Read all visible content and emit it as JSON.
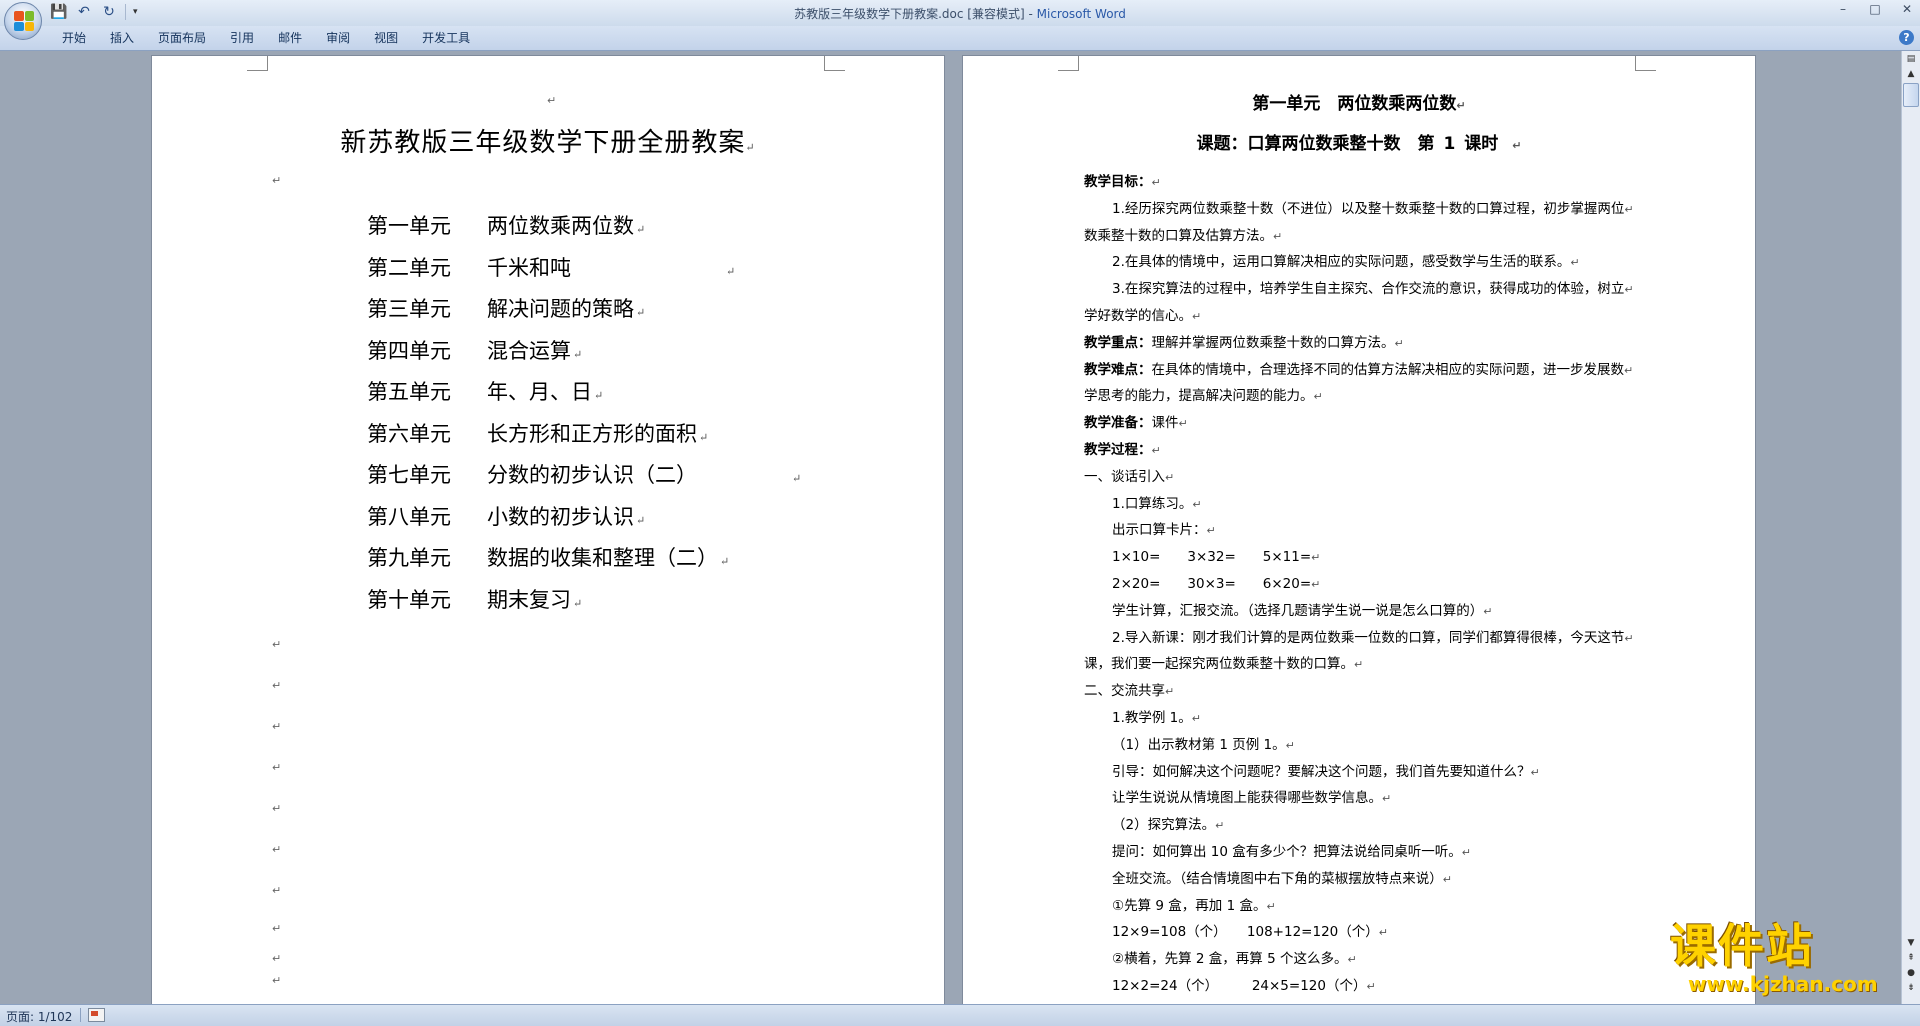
{
  "window": {
    "title_doc": "苏教版三年级数学下册教案.doc [兼容模式]",
    "title_app": "Microsoft Word",
    "controls": [
      "–",
      "□",
      "✕"
    ]
  },
  "qat": {
    "save_icon": "💾",
    "undo_icon": "↶",
    "redo_icon": "↻",
    "customize_icon": "▾"
  },
  "ribbon": {
    "tabs": [
      "开始",
      "插入",
      "页面布局",
      "引用",
      "邮件",
      "审阅",
      "视图",
      "开发工具"
    ],
    "help_icon": "?"
  },
  "left_page": {
    "title": "新苏教版三年级数学下册全册教案",
    "units": [
      {
        "num": "第一单元",
        "name": "两位数乘两位数"
      },
      {
        "num": "第二单元",
        "name": "千米和吨"
      },
      {
        "num": "第三单元",
        "name": "解决问题的策略"
      },
      {
        "num": "第四单元",
        "name": "混合运算"
      },
      {
        "num": "第五单元",
        "name": "年、月、日"
      },
      {
        "num": "第六单元",
        "name": "长方形和正方形的面积"
      },
      {
        "num": "第七单元",
        "name": "分数的初步认识（二）"
      },
      {
        "num": "第八单元",
        "name": "小数的初步认识"
      },
      {
        "num": "第九单元",
        "name": "数据的收集和整理（二）"
      },
      {
        "num": "第十单元",
        "name": "期末复习"
      }
    ]
  },
  "right_page": {
    "heading1": "第一单元　两位数乘两位数",
    "heading2": "课题：口算两位数乘整十数　第 1 课时",
    "lines": [
      {
        "bold": "教学目标：",
        "text": "",
        "indent": false
      },
      {
        "bold": "",
        "text": "1.经历探究两位数乘整十数（不进位）以及整十数乘整十数的口算过程，初步掌握两位",
        "indent": true
      },
      {
        "bold": "",
        "text": "数乘整十数的口算及估算方法。",
        "indent": false
      },
      {
        "bold": "",
        "text": "2.在具体的情境中，运用口算解决相应的实际问题，感受数学与生活的联系。",
        "indent": true
      },
      {
        "bold": "",
        "text": "3.在探究算法的过程中，培养学生自主探究、合作交流的意识，获得成功的体验，树立",
        "indent": true
      },
      {
        "bold": "",
        "text": "学好数学的信心。",
        "indent": false
      },
      {
        "bold": "教学重点：",
        "text": "理解并掌握两位数乘整十数的口算方法。",
        "indent": false
      },
      {
        "bold": "教学难点：",
        "text": "在具体的情境中，合理选择不同的估算方法解决相应的实际问题，进一步发展数",
        "indent": false
      },
      {
        "bold": "",
        "text": "学思考的能力，提高解决问题的能力。",
        "indent": false
      },
      {
        "bold": "教学准备：",
        "text": "课件",
        "indent": false
      },
      {
        "bold": "教学过程：",
        "text": "",
        "indent": false
      },
      {
        "bold": "",
        "text": "一、谈话引入",
        "indent": false
      },
      {
        "bold": "",
        "text": "1.口算练习。",
        "indent": true
      },
      {
        "bold": "",
        "text": "出示口算卡片：",
        "indent": true
      },
      {
        "bold": "",
        "text": "1×10=　　3×32=　　5×11=",
        "indent": true
      },
      {
        "bold": "",
        "text": "2×20=　　30×3=　　6×20=",
        "indent": true
      },
      {
        "bold": "",
        "text": "学生计算，汇报交流。（选择几题请学生说一说是怎么口算的）",
        "indent": true
      },
      {
        "bold": "",
        "text": "2.导入新课：刚才我们计算的是两位数乘一位数的口算，同学们都算得很棒，今天这节",
        "indent": true
      },
      {
        "bold": "",
        "text": "课，我们要一起探究两位数乘整十数的口算。",
        "indent": false
      },
      {
        "bold": "",
        "text": "二、交流共享",
        "indent": false
      },
      {
        "bold": "",
        "text": "1.教学例 1。",
        "indent": true
      },
      {
        "bold": "",
        "text": "（1）出示教材第 1 页例 1。",
        "indent": true
      },
      {
        "bold": "",
        "text": "引导：如何解决这个问题呢？要解决这个问题，我们首先要知道什么？",
        "indent": true
      },
      {
        "bold": "",
        "text": "让学生说说从情境图上能获得哪些数学信息。",
        "indent": true
      },
      {
        "bold": "",
        "text": "（2）探究算法。",
        "indent": true
      },
      {
        "bold": "",
        "text": "提问：如何算出 10 盒有多少个？把算法说给同桌听一听。",
        "indent": true
      },
      {
        "bold": "",
        "text": "全班交流。（结合情境图中右下角的菜椒摆放特点来说）",
        "indent": true
      },
      {
        "bold": "",
        "text": "①先算 9 盒，再加 1 盒。",
        "indent": true
      },
      {
        "bold": "",
        "text": "12×9=108（个）　　108+12=120（个）",
        "indent": true
      },
      {
        "bold": "",
        "text": "②横着，先算 2 盒，再算 5 个这么多。",
        "indent": true
      },
      {
        "bold": "",
        "text": "12×2=24（个）　　　24×5=120（个）",
        "indent": true
      }
    ]
  },
  "paragraph_mark": "↵",
  "watermark": {
    "brand": "课件站",
    "url": "www.kjzhan.com"
  },
  "statusbar": {
    "page": "页面: 1/102"
  }
}
